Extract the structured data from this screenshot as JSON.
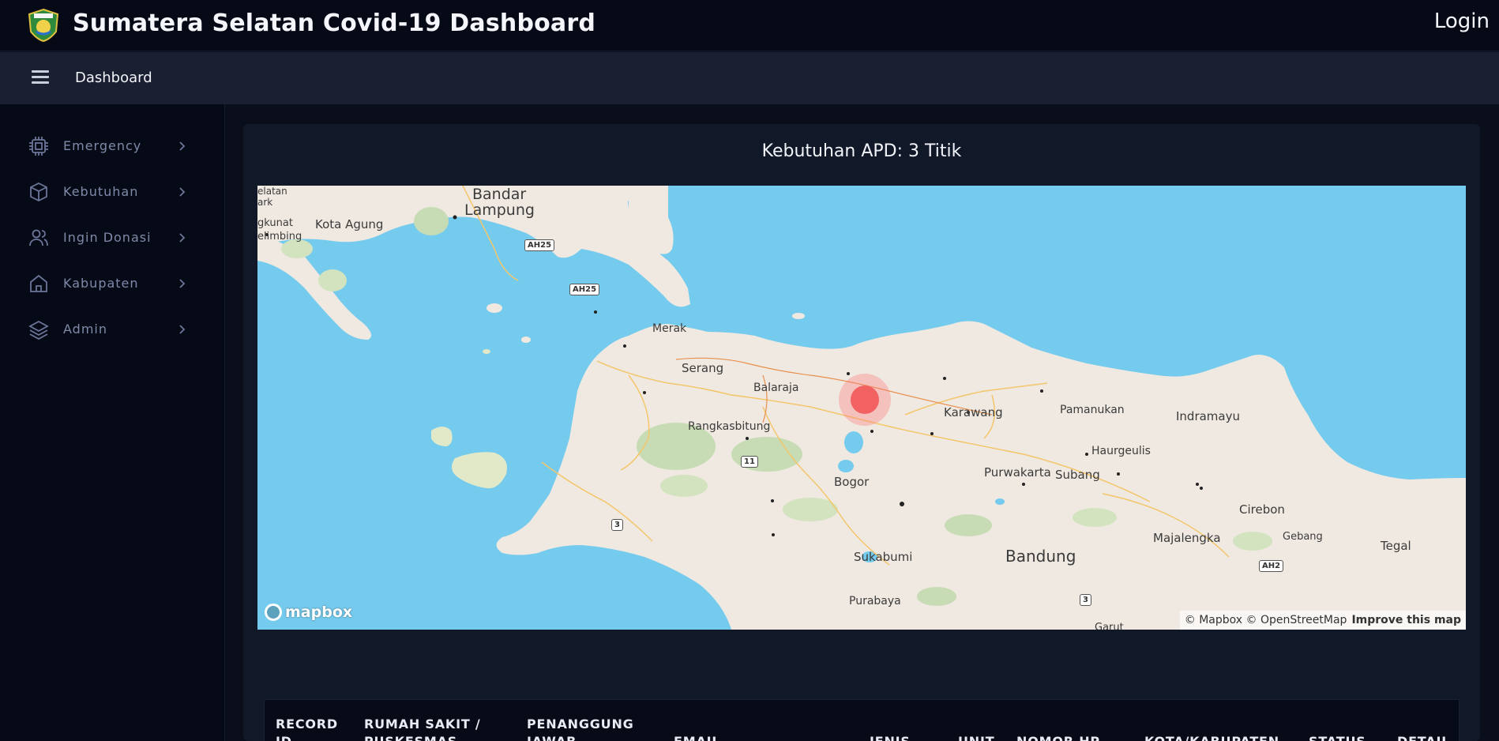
{
  "header": {
    "title": "Sumatera Selatan Covid-19 Dashboard",
    "login_label": "Login",
    "logo_icon": "province-emblem-logo"
  },
  "subheader": {
    "menu_icon": "hamburger-menu-icon",
    "breadcrumb": "Dashboard"
  },
  "sidebar": {
    "items": [
      {
        "label": "Emergency",
        "icon": "chip-icon"
      },
      {
        "label": "Kebutuhan",
        "icon": "box-icon"
      },
      {
        "label": "Ingin Donasi",
        "icon": "users-icon"
      },
      {
        "label": "Kabupaten",
        "icon": "home-icon"
      },
      {
        "label": "Admin",
        "icon": "layers-icon"
      }
    ]
  },
  "main": {
    "title": "Kebutuhan APD: 3 Titik",
    "map": {
      "places": [
        "Bandar",
        "Lampung",
        "Kota Agung",
        "elatan",
        "ark",
        "gkunat",
        "elimbing",
        "Merak",
        "Serang",
        "Balaraja",
        "Rangkasbitung",
        "Karawang",
        "Pamanukan",
        "Indramayu",
        "Haurgeulis",
        "Purwakarta",
        "Subang",
        "Bogor",
        "Cirebon",
        "Majalengka",
        "Gebang",
        "Tegal",
        "Sukabumi",
        "Bandung",
        "Purabaya",
        "Garut"
      ],
      "road_shields": [
        "AH25",
        "AH25",
        "11",
        "3",
        "3",
        "AH2"
      ],
      "logo": "mapbox",
      "attribution": "© Mapbox © OpenStreetMap",
      "improve_link": "Improve this map"
    },
    "table": {
      "columns": [
        "RECORD ID",
        "RUMAH SAKIT / PUSKESMAS",
        "PENANGGUNG JAWAB",
        "EMAIL",
        "JENIS",
        "UNIT",
        "NOMOR HP",
        "KOTA/KABUPATEN",
        "STATUS",
        "DETAIL"
      ]
    }
  },
  "colors": {
    "background": "#0a0e1a",
    "header": "#060a17",
    "subheader": "#1a1f31",
    "card": "#111828",
    "water": "#75cbed",
    "land": "#efe9e1",
    "marker": "#f26262"
  }
}
